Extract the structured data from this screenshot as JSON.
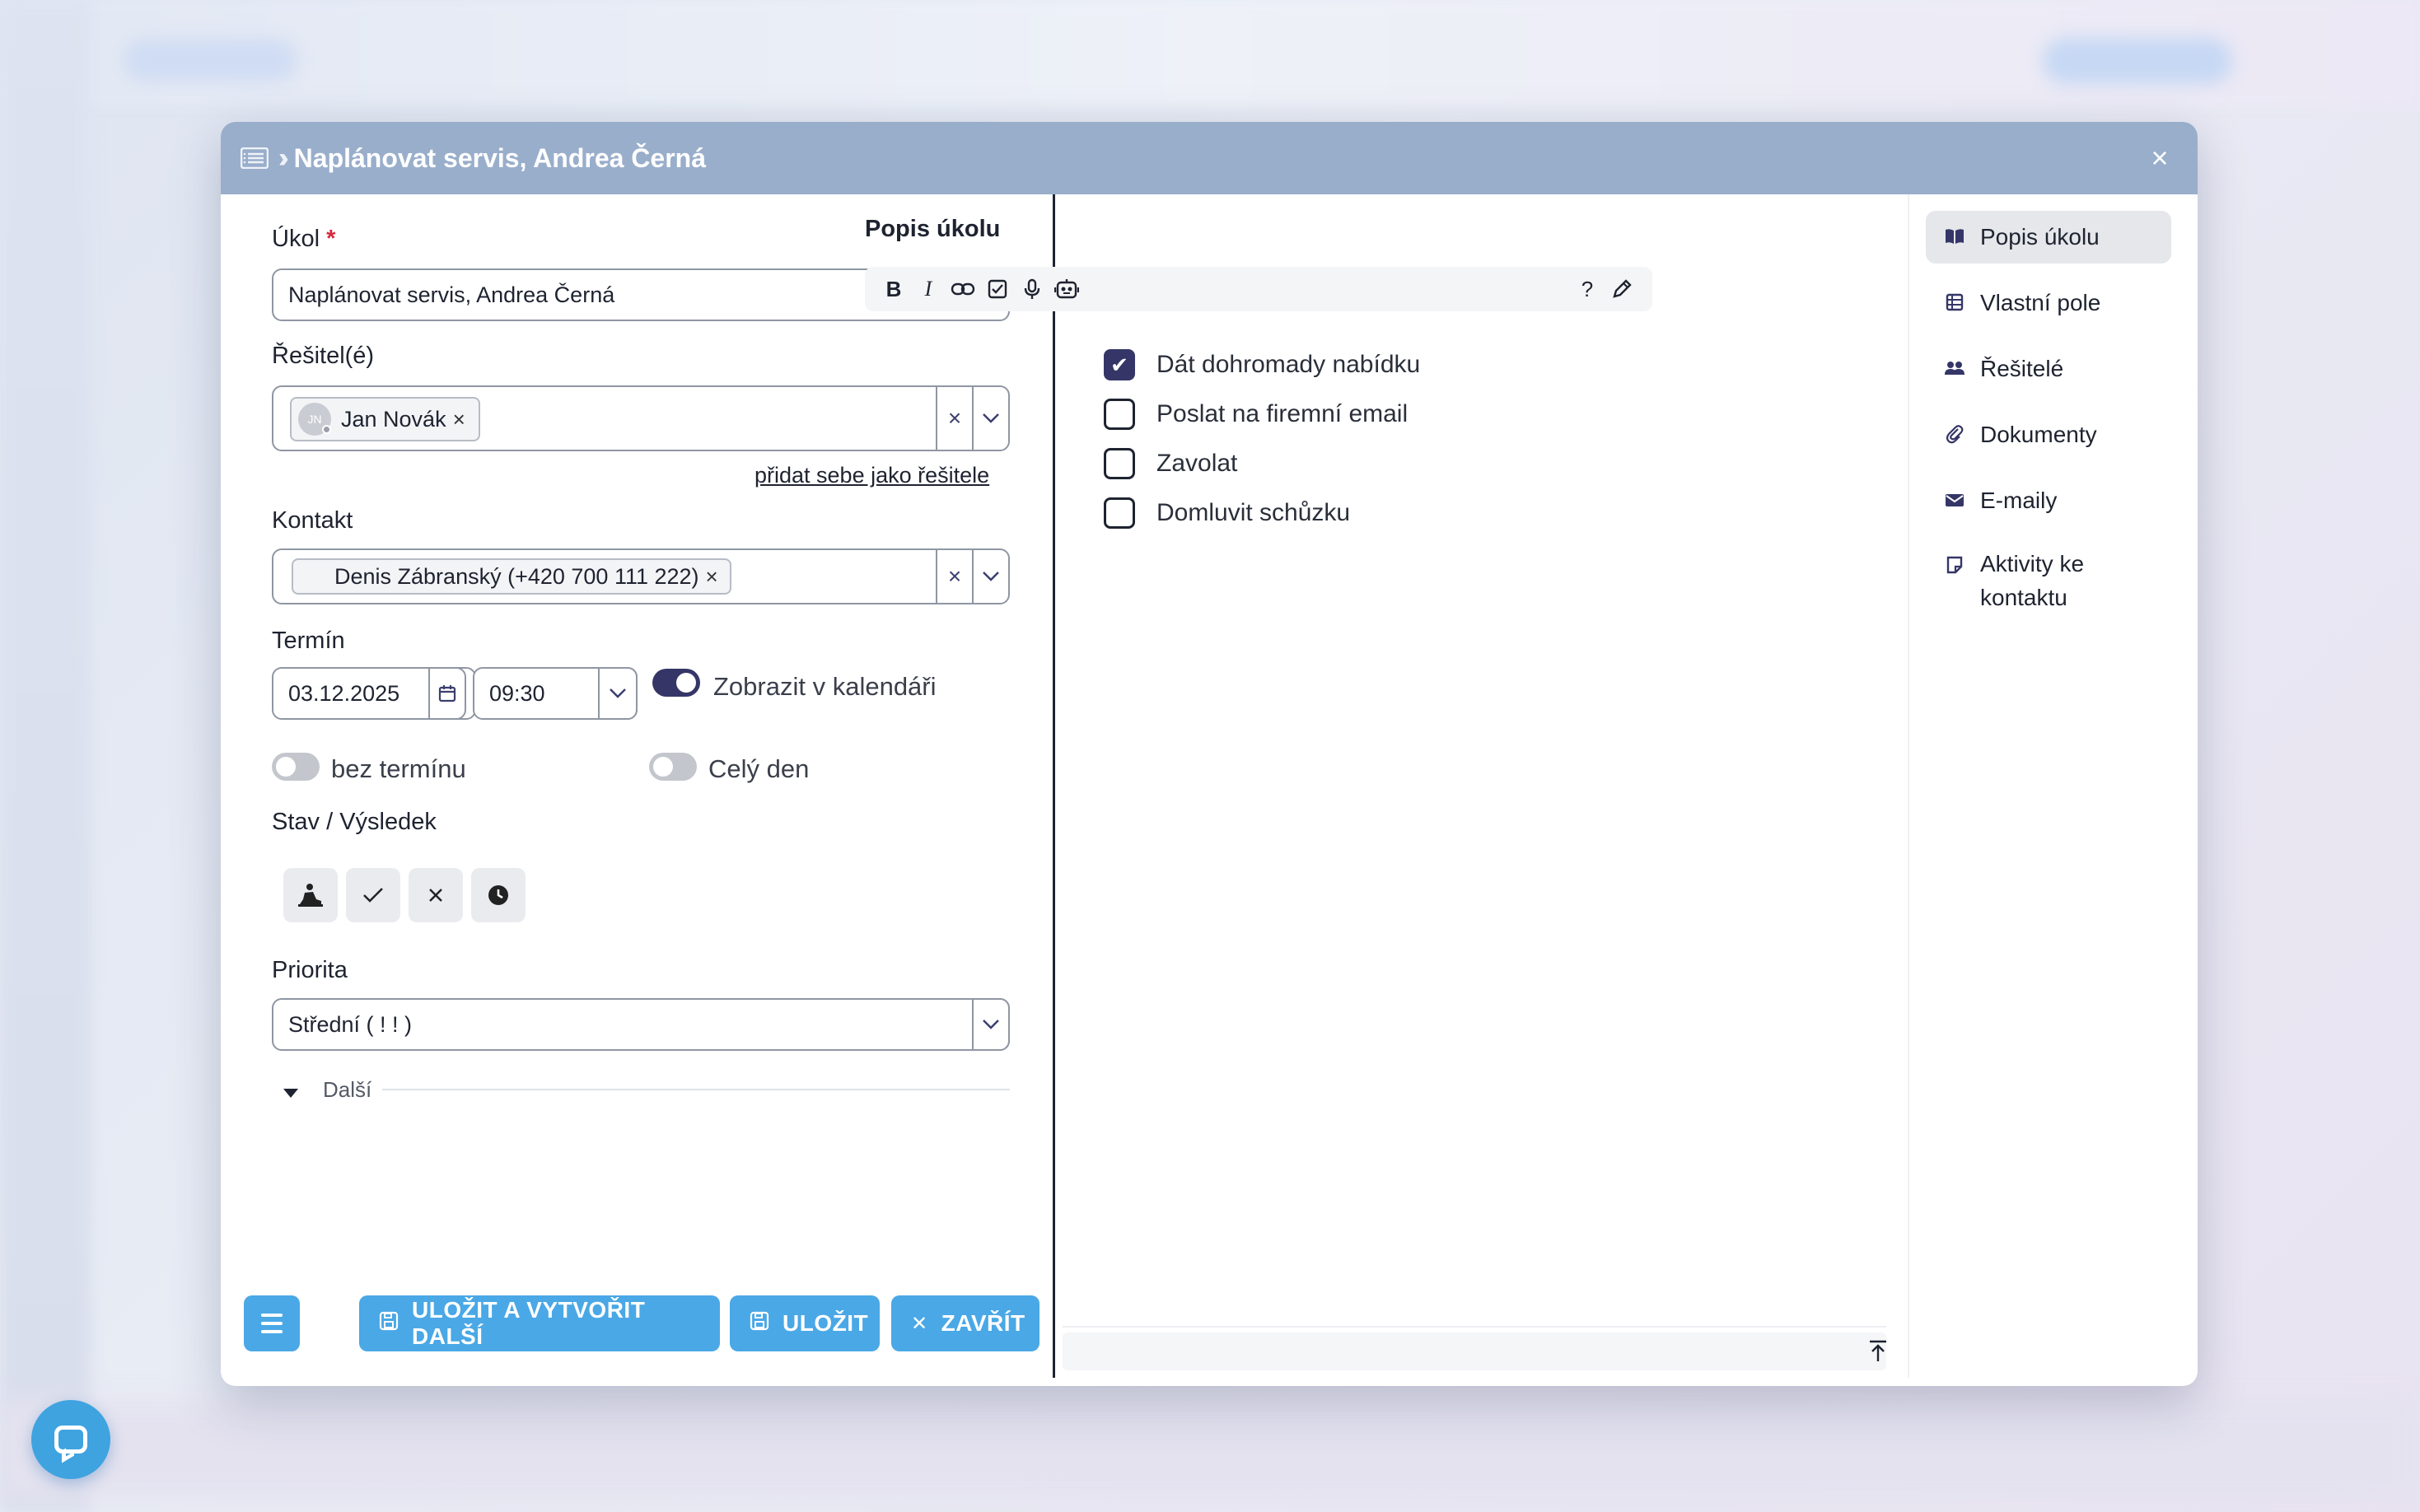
{
  "modal": {
    "title": "Naplánovat servis, Andrea Černá",
    "close_label": "×"
  },
  "form": {
    "task": {
      "label": "Úkol",
      "required_mark": "*",
      "value": "Naplánovat servis, Andrea Černá"
    },
    "assignees": {
      "label": "Řešitel(é)",
      "tags": [
        {
          "name": "Jan Novák",
          "initials": "JN"
        }
      ],
      "add_self_link": "přidat sebe jako řešitele"
    },
    "contact": {
      "label": "Kontakt",
      "tags": [
        {
          "name": "Denis Zábranský (+420 700 111 222)"
        }
      ]
    },
    "deadline": {
      "label": "Termín",
      "date": "03.12.2025",
      "time": "09:30",
      "show_in_calendar": {
        "label": "Zobrazit v kalendáři",
        "on": true
      },
      "no_deadline": {
        "label": "bez termínu",
        "on": false
      },
      "all_day": {
        "label": "Celý den",
        "on": false
      }
    },
    "status": {
      "label": "Stav / Výsledek",
      "buttons": [
        "in-progress-icon",
        "done-icon",
        "cancel-icon",
        "clock-icon"
      ]
    },
    "priority": {
      "label": "Priorita",
      "value": "Střední ( ! ! )"
    },
    "more": {
      "label": "Další"
    }
  },
  "footer": {
    "save_and_new": "ULOŽIT A VYTVOŘIT DALŠÍ",
    "save": "ULOŽIT",
    "close": "ZAVŘÍT"
  },
  "description": {
    "title": "Popis úkolu",
    "toolbar": [
      "bold-icon",
      "italic-icon",
      "link-icon",
      "checkbox-icon",
      "microphone-icon",
      "robot-icon",
      "help-icon",
      "pencil-icon"
    ],
    "checklist": [
      {
        "text": "Dát dohromady nabídku",
        "checked": true
      },
      {
        "text": "Poslat na firemní email",
        "checked": false
      },
      {
        "text": "Zavolat",
        "checked": false
      },
      {
        "text": "Domluvit schůzku",
        "checked": false
      }
    ]
  },
  "sidenav": {
    "items": [
      {
        "label": "Popis úkolu",
        "icon": "book-icon",
        "active": true
      },
      {
        "label": "Vlastní pole",
        "icon": "table-icon",
        "active": false
      },
      {
        "label": "Řešitelé",
        "icon": "users-icon",
        "active": false
      },
      {
        "label": "Dokumenty",
        "icon": "paperclip-icon",
        "active": false
      },
      {
        "label": "E-maily",
        "icon": "envelope-icon",
        "active": false
      },
      {
        "label": "Aktivity ke kontaktu",
        "icon": "note-icon",
        "active": false
      }
    ]
  },
  "colors": {
    "header": "#99aecb",
    "accent": "#4aa8e6",
    "toggle_on": "#353667"
  }
}
